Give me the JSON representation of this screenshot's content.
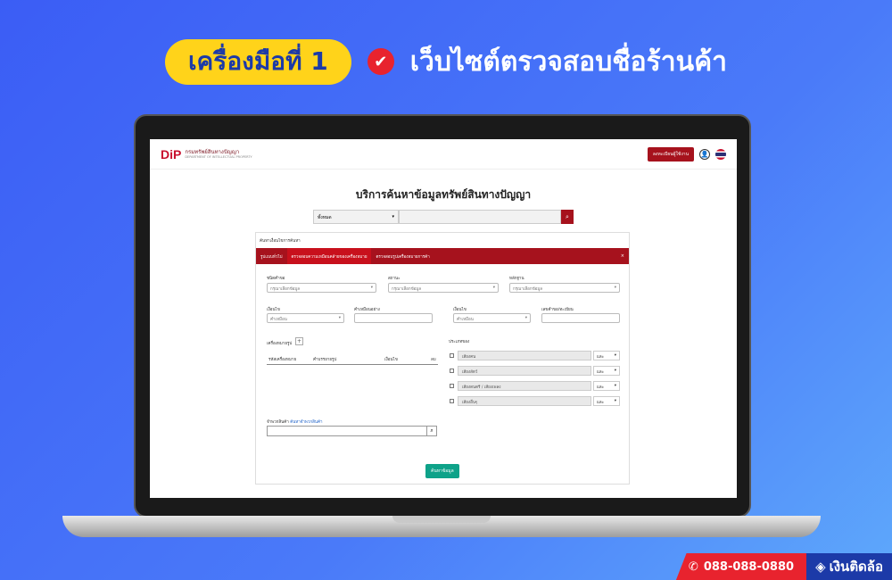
{
  "headline": {
    "badge": "เครื่องมือที่ 1",
    "check": "✔",
    "title": "เว็บไซต์ตรวจสอบชื่อร้านค้า"
  },
  "site": {
    "logo_mark": "DiP",
    "logo_name": "กรมทรัพย์สินทางปัญญา",
    "logo_sub": "DEPARTMENT OF INTELLECTUAL PROPERTY",
    "register_btn": "ลงทะเบียนผู้ใช้งาน",
    "user_icon": "user-icon",
    "flag_icon": "thai-flag-icon"
  },
  "page_title": "บริการค้นหาข้อมูลทรัพย์สินทางปัญญา",
  "search": {
    "select_value": "ทั้งหมด",
    "caret": "▾",
    "icon": "🔍"
  },
  "panel": {
    "head": "ค้นหาเงื่อนไขการค้นหา",
    "tabs": [
      "รูปแบบทั่วไป",
      "ตรวจสอบความเหมือนคล้ายของเครื่องหมาย",
      "ตรวจสอบรูปเครื่องหมายการค้า"
    ],
    "close": "×",
    "labels": {
      "type": "ชนิดคำขอ",
      "status": "สถานะ",
      "evidence": "หลักฐาน",
      "cond1": "เงื่อนไข",
      "word": "คำเหมือนอย่าง",
      "cond2": "เงื่อนไข",
      "regno": "เลขคำขอ/ทะเบียน",
      "groups": "เครื่องหมายรูป",
      "section": "ประเภทของ",
      "classify": "จำพวกสินค้า",
      "classify_link": "ค้นหาจำพวกสินค้า"
    },
    "selects": {
      "type": "กรุณาเลือกข้อมูล",
      "status": "กรุณาเลือกข้อมูล",
      "evidence": "กรุณาเลือกข้อมูล",
      "cond1": "คำเหมือน",
      "cond2": "คำเหมือน"
    },
    "table_headers": [
      "รหัสเครื่องหมาย",
      "คำบรรยายรูป",
      "เงื่อนไข",
      "ลบ"
    ],
    "groups_rows": [
      {
        "label": "เสียงคน",
        "op": "และ"
      },
      {
        "label": "เสียงสัตว์",
        "op": "และ"
      },
      {
        "label": "เสียงดนตรี / เสียงเพลง",
        "op": "และ"
      },
      {
        "label": "เสียงอื่นๆ",
        "op": "และ"
      }
    ],
    "add": "+",
    "submit": "ค้นหาข้อมูล"
  },
  "footer": {
    "phone": "088-088-0880",
    "brand": "เงินติดล้อ"
  },
  "colors": {
    "accent": "#a6121d",
    "go": "#0ea289",
    "yellow": "#ffd31a"
  }
}
